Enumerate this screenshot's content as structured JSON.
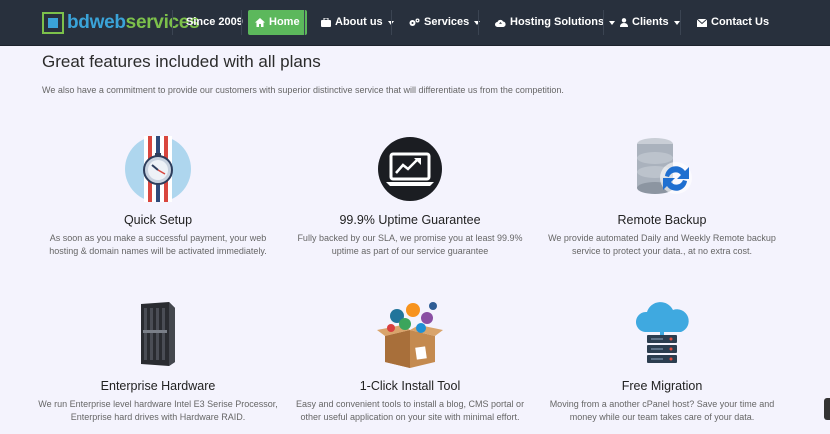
{
  "brand": {
    "name_part1": "bdweb",
    "name_part2": "services"
  },
  "nav": {
    "since": "Since 2009",
    "home": "Home",
    "about": "About us",
    "services": "Services",
    "hosting": "Hosting Solutions",
    "clients": "Clients",
    "contact": "Contact Us"
  },
  "section": {
    "title": "Great features included with all plans",
    "subtitle": "We also have a commitment to provide our customers with superior distinctive service that will differentiate us from the competition."
  },
  "features": [
    {
      "title": "Quick Setup",
      "desc": "As soon as you make a successful payment, your web hosting & domain names will be activated immediately."
    },
    {
      "title": "99.9% Uptime Guarantee",
      "desc": "Fully backed by our SLA, we promise you at least 99.9% uptime as part of our service guarantee"
    },
    {
      "title": "Remote Backup",
      "desc": "We provide automated Daily and Weekly Remote backup service to protect your data., at no extra cost."
    },
    {
      "title": "Enterprise Hardware",
      "desc": "We run Enterprise level hardware Intel E3 Serise Processor, Enterprise hard drives with Hardware RAID."
    },
    {
      "title": "1-Click Install Tool",
      "desc": "Easy and convenient tools to install a blog, CMS portal or other useful application on your site with minimal effort."
    },
    {
      "title": "Free Migration",
      "desc": "Moving from a another cPanel host? Save your time and money while our team takes care of your data."
    }
  ],
  "colors": {
    "nav_bg": "#28303d",
    "active": "#5cb85c",
    "brand_blue": "#3aa3d8",
    "brand_green": "#7cc04b",
    "page_bg": "#f4f3fd"
  }
}
